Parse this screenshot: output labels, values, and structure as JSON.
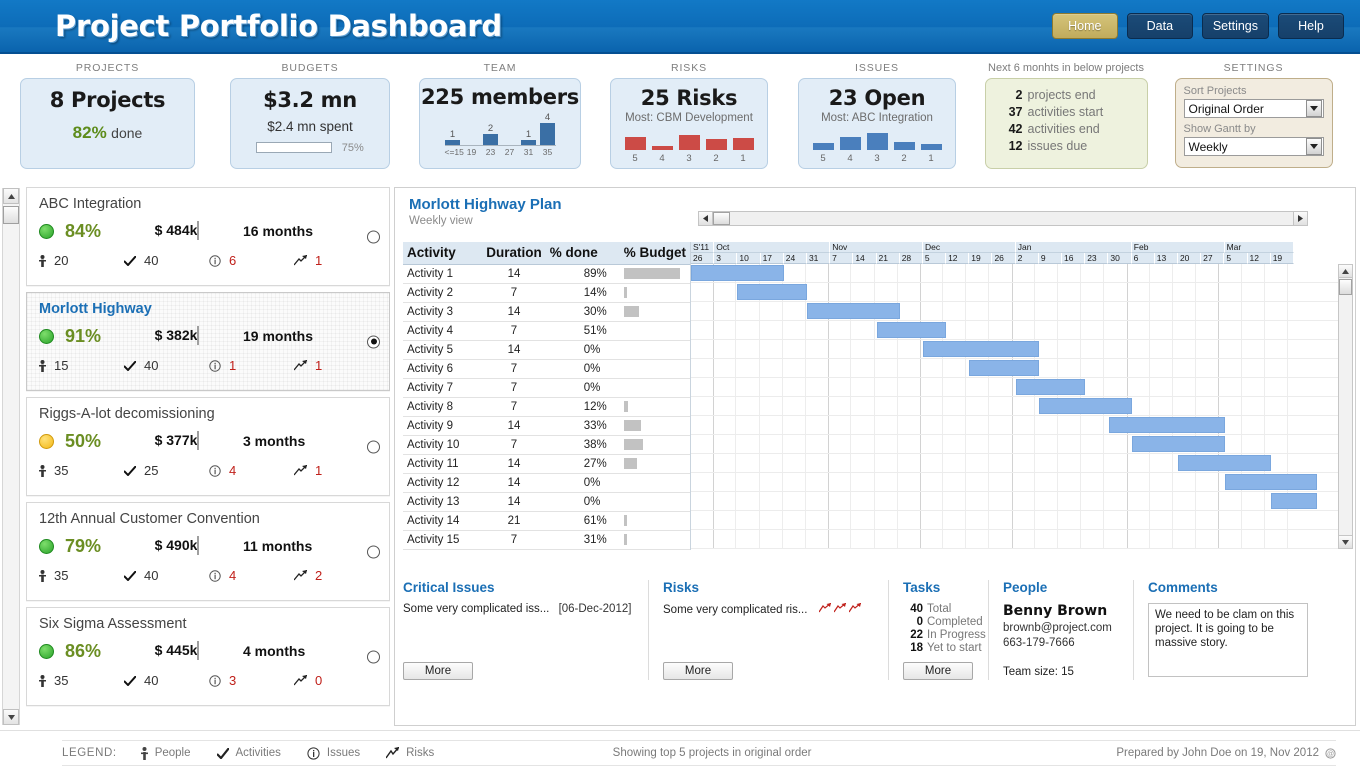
{
  "header": {
    "title": "Project Portfolio Dashboard",
    "nav": [
      {
        "label": "Home",
        "active": true
      },
      {
        "label": "Data",
        "active": false
      },
      {
        "label": "Settings",
        "active": false
      },
      {
        "label": "Help",
        "active": false
      }
    ]
  },
  "kpis": {
    "projects": {
      "caption": "PROJECTS",
      "big": "8 Projects",
      "pct": "82%",
      "done_label": "done"
    },
    "budgets": {
      "caption": "BUDGETS",
      "big": "$3.2 mn",
      "spent": "$2.4 mn spent",
      "bar_pct": 75,
      "bar_label": "75%"
    },
    "team": {
      "caption": "TEAM",
      "big": "225 members",
      "hist_values": [
        1,
        0,
        2,
        0,
        1,
        4
      ],
      "hist_labels": [
        "1",
        "",
        "2",
        "",
        "1",
        "4"
      ],
      "axis_ticks": [
        "<=15",
        "19",
        "23",
        "27",
        "31",
        "35"
      ]
    },
    "risks": {
      "caption": "RISKS",
      "big": "25 Risks",
      "note": "Most: CBM Development",
      "bars": [
        {
          "label": "5",
          "height": 13
        },
        {
          "label": "4",
          "height": 4
        },
        {
          "label": "3",
          "height": 15
        },
        {
          "label": "2",
          "height": 11
        },
        {
          "label": "1",
          "height": 12
        }
      ],
      "color": "#cc4b46"
    },
    "issues": {
      "caption": "ISSUES",
      "big": "23 Open",
      "note": "Most: ABC Integration",
      "bars": [
        {
          "label": "5",
          "height": 7
        },
        {
          "label": "4",
          "height": 13
        },
        {
          "label": "3",
          "height": 17
        },
        {
          "label": "2",
          "height": 8
        },
        {
          "label": "1",
          "height": 6
        }
      ],
      "color": "#4a7fbd"
    },
    "upcoming": {
      "caption": "Next 6 monhts in below projects",
      "items": [
        {
          "num": "2",
          "label": "projects end"
        },
        {
          "num": "37",
          "label": "activities start"
        },
        {
          "num": "42",
          "label": "activities end"
        },
        {
          "num": "12",
          "label": "issues due"
        }
      ]
    },
    "settings": {
      "caption": "SETTINGS",
      "sort_label": "Sort Projects",
      "sort_value": "Original Order",
      "gantt_label": "Show Gantt by",
      "gantt_value": "Weekly"
    }
  },
  "projects": [
    {
      "name": "ABC Integration",
      "status": "green",
      "pct": "84%",
      "budget": "$ 484k",
      "budget_fill": 72,
      "months": "16 months",
      "people": "20",
      "activities": "40",
      "issues": "6",
      "risks": "1",
      "selected": false
    },
    {
      "name": "Morlott Highway",
      "status": "green",
      "pct": "91%",
      "budget": "$ 382k",
      "budget_fill": 62,
      "months": "19 months",
      "people": "15",
      "activities": "40",
      "issues": "1",
      "risks": "1",
      "selected": true
    },
    {
      "name": "Riggs-A-lot decomissioning",
      "status": "amber",
      "pct": "50%",
      "budget": "$ 377k",
      "budget_fill": 52,
      "months": "3 months",
      "people": "35",
      "activities": "25",
      "issues": "4",
      "risks": "1",
      "selected": false
    },
    {
      "name": "12th Annual Customer Convention",
      "status": "green",
      "pct": "79%",
      "budget": "$ 490k",
      "budget_fill": 76,
      "months": "11 months",
      "people": "35",
      "activities": "40",
      "issues": "4",
      "risks": "2",
      "selected": false
    },
    {
      "name": "Six Sigma Assessment",
      "status": "green",
      "pct": "86%",
      "budget": "$ 445k",
      "budget_fill": 66,
      "months": "4 months",
      "people": "35",
      "activities": "40",
      "issues": "3",
      "risks": "0",
      "selected": false
    }
  ],
  "gantt": {
    "title": "Morlott Highway Plan",
    "subtitle": "Weekly view",
    "columns": [
      "Activity",
      "Duration",
      "% done",
      "% Budget"
    ],
    "timeline": {
      "months": [
        {
          "label": "S'11",
          "weeks": [
            "26"
          ]
        },
        {
          "label": "Oct",
          "weeks": [
            "3",
            "10",
            "17",
            "24",
            "31"
          ]
        },
        {
          "label": "Nov",
          "weeks": [
            "7",
            "14",
            "21",
            "28"
          ]
        },
        {
          "label": "Dec",
          "weeks": [
            "5",
            "12",
            "19",
            "26"
          ]
        },
        {
          "label": "Jan",
          "weeks": [
            "2",
            "9",
            "16",
            "23",
            "30"
          ]
        },
        {
          "label": "Feb",
          "weeks": [
            "6",
            "13",
            "20",
            "27"
          ]
        },
        {
          "label": "Mar",
          "weeks": [
            "5",
            "12",
            "19"
          ]
        }
      ]
    },
    "rows": [
      {
        "name": "Activity 1",
        "duration": "14",
        "status": "green",
        "done": "89%",
        "budget_w": 56,
        "bar_start": 0,
        "bar_len": 4
      },
      {
        "name": "Activity 2",
        "duration": "7",
        "status": "red",
        "done": "14%",
        "budget_w": 3,
        "bar_start": 2,
        "bar_len": 3
      },
      {
        "name": "Activity 3",
        "duration": "14",
        "status": "red",
        "done": "30%",
        "budget_w": 15,
        "bar_start": 5,
        "bar_len": 4
      },
      {
        "name": "Activity 4",
        "duration": "7",
        "status": "amber",
        "done": "51%",
        "budget_w": 0,
        "bar_start": 8,
        "bar_len": 3
      },
      {
        "name": "Activity 5",
        "duration": "14",
        "status": "red",
        "done": "0%",
        "budget_w": 0,
        "bar_start": 10,
        "bar_len": 5
      },
      {
        "name": "Activity 6",
        "duration": "7",
        "status": "red",
        "done": "0%",
        "budget_w": 0,
        "bar_start": 12,
        "bar_len": 3
      },
      {
        "name": "Activity 7",
        "duration": "7",
        "status": "red",
        "done": "0%",
        "budget_w": 0,
        "bar_start": 14,
        "bar_len": 3
      },
      {
        "name": "Activity 8",
        "duration": "7",
        "status": "red",
        "done": "12%",
        "budget_w": 4,
        "bar_start": 15,
        "bar_len": 4
      },
      {
        "name": "Activity 9",
        "duration": "14",
        "status": "red",
        "done": "33%",
        "budget_w": 17,
        "bar_start": 18,
        "bar_len": 5
      },
      {
        "name": "Activity 10",
        "duration": "7",
        "status": "red",
        "done": "38%",
        "budget_w": 19,
        "bar_start": 19,
        "bar_len": 4
      },
      {
        "name": "Activity 11",
        "duration": "14",
        "status": "red",
        "done": "27%",
        "budget_w": 13,
        "bar_start": 21,
        "bar_len": 4
      },
      {
        "name": "Activity 12",
        "duration": "14",
        "status": "red",
        "done": "0%",
        "budget_w": 0,
        "bar_start": 23,
        "bar_len": 4
      },
      {
        "name": "Activity 13",
        "duration": "14",
        "status": "red",
        "done": "0%",
        "budget_w": 0,
        "bar_start": 25,
        "bar_len": 2
      },
      {
        "name": "Activity 14",
        "duration": "21",
        "status": "amber",
        "done": "61%",
        "budget_w": 3,
        "bar_start": -1,
        "bar_len": 0
      },
      {
        "name": "Activity 15",
        "duration": "7",
        "status": "red",
        "done": "31%",
        "budget_w": 3,
        "bar_start": -1,
        "bar_len": 0
      }
    ]
  },
  "details": {
    "issues": {
      "title": "Critical Issues",
      "text": "Some very complicated iss...",
      "date": "[06-Dec-2012]",
      "more": "More"
    },
    "risks": {
      "title": "Risks",
      "text": "Some very complicated ris...",
      "icons": 3,
      "more": "More"
    },
    "tasks": {
      "title": "Tasks",
      "lines": [
        {
          "num": "40",
          "label": "Total"
        },
        {
          "num": "0",
          "label": "Completed"
        },
        {
          "num": "22",
          "label": "In Progress"
        },
        {
          "num": "18",
          "label": "Yet to start"
        }
      ],
      "more": "More"
    },
    "people": {
      "title": "People",
      "name": "Benny Brown",
      "email": "brownb@project.com",
      "phone": "663-179-7666",
      "team_size": "Team size: 15"
    },
    "comments": {
      "title": "Comments",
      "text": "We need to be clam on this project. It is going to be massive story."
    }
  },
  "footer": {
    "legend_label": "LEGEND:",
    "legend": [
      {
        "icon": "person-icon",
        "label": "People"
      },
      {
        "icon": "check-icon",
        "label": "Activities"
      },
      {
        "icon": "info-icon",
        "label": "Issues"
      },
      {
        "icon": "risk-icon",
        "label": "Risks"
      }
    ],
    "center": "Showing top 5 projects in original order",
    "right": "Prepared by John Doe on 19, Nov 2012"
  }
}
